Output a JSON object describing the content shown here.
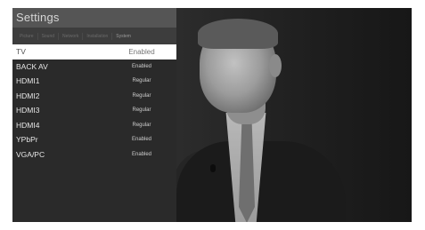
{
  "settings": {
    "title": "Settings",
    "tabs": [
      "Picture",
      "Sound",
      "Network",
      "Installation",
      "System"
    ],
    "active_tab": "System",
    "rows": [
      {
        "name": "TV",
        "value": "Enabled",
        "selected": true
      },
      {
        "name": "BACK AV",
        "value": "Enabled",
        "selected": false
      },
      {
        "name": "HDMI1",
        "value": "Regular",
        "selected": false
      },
      {
        "name": "HDMI2",
        "value": "Regular",
        "selected": false
      },
      {
        "name": "HDMI3",
        "value": "Regular",
        "selected": false
      },
      {
        "name": "HDMI4",
        "value": "Regular",
        "selected": false
      },
      {
        "name": "YPbPr",
        "value": "Enabled",
        "selected": false
      },
      {
        "name": "VGA/PC",
        "value": "Enabled",
        "selected": false
      }
    ]
  },
  "colors": {
    "panel_bg": "#2a2a2a",
    "header_bg": "#555555",
    "selected_row_bg": "#ffffff"
  }
}
